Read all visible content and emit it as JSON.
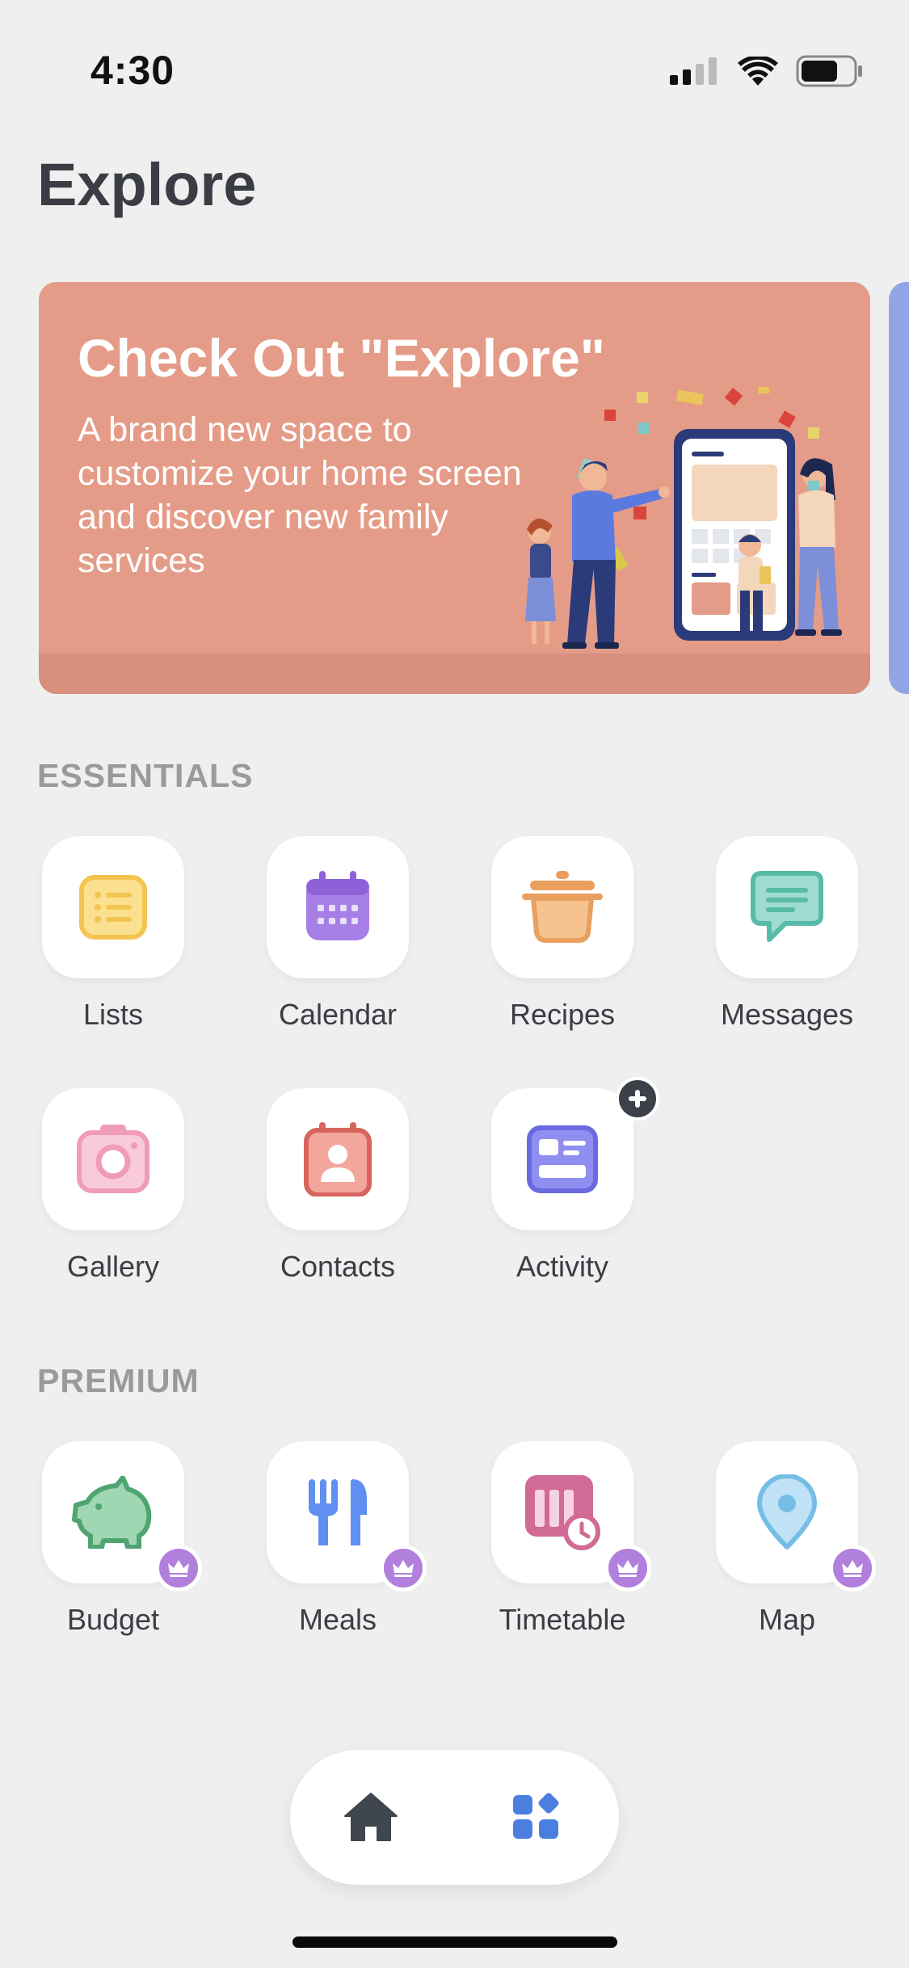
{
  "status_bar": {
    "time": "4:30"
  },
  "page_title": "Explore",
  "banner": {
    "title": "Check Out \"Explore\"",
    "text": "A brand new space to customize your home screen and discover new family services"
  },
  "essentials": {
    "label": "ESSENTIALS",
    "items": [
      {
        "label": "Lists",
        "icon": "list-icon"
      },
      {
        "label": "Calendar",
        "icon": "calendar-icon"
      },
      {
        "label": "Recipes",
        "icon": "pot-icon"
      },
      {
        "label": "Messages",
        "icon": "message-icon"
      },
      {
        "label": "Gallery",
        "icon": "camera-icon"
      },
      {
        "label": "Contacts",
        "icon": "contact-card-icon"
      },
      {
        "label": "Activity",
        "icon": "activity-icon"
      }
    ]
  },
  "premium": {
    "label": "PREMIUM",
    "items": [
      {
        "label": "Budget",
        "icon": "piggy-bank-icon"
      },
      {
        "label": "Meals",
        "icon": "fork-knife-icon"
      },
      {
        "label": "Timetable",
        "icon": "timetable-icon"
      },
      {
        "label": "Map",
        "icon": "location-pin-icon"
      }
    ]
  },
  "bottom_nav": {
    "items": [
      "home-icon",
      "apps-icon"
    ]
  },
  "colors": {
    "background": "#efefef",
    "banner": "#e49c88",
    "premium_badge": "#b180dc",
    "nav_active": "#4a7fe0"
  }
}
